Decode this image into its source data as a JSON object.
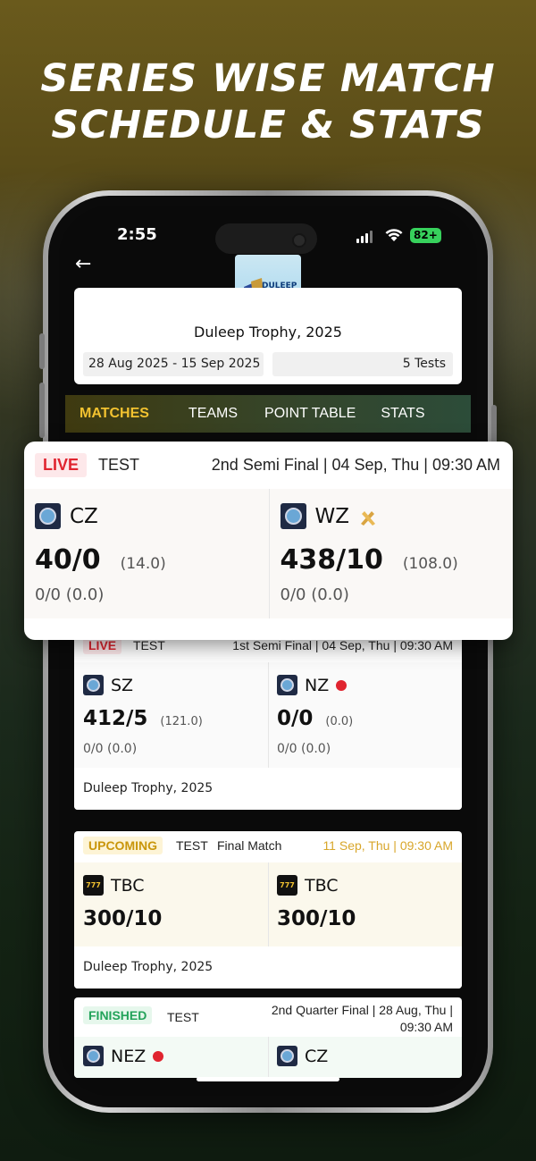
{
  "headline": {
    "line1": "SERIES WISE MATCH",
    "line2": "SCHEDULE & STATS"
  },
  "status": {
    "time": "2:55",
    "battery": "82+"
  },
  "series": {
    "logo_text": "DULEEP",
    "name": "Duleep Trophy, 2025",
    "dates": "28 Aug 2025 - 15 Sep 2025",
    "tests": "5 Tests"
  },
  "tabs": [
    {
      "label": "MATCHES",
      "active": true
    },
    {
      "label": "TEAMS",
      "active": false
    },
    {
      "label": "POINT TABLE",
      "active": false
    },
    {
      "label": "STATS",
      "active": false
    }
  ],
  "popup": {
    "badge": "LIVE",
    "format": "TEST",
    "info": "2nd Semi Final  |  04 Sep, Thu  |  09:30 AM",
    "team1": {
      "name": "CZ",
      "score": "40/0",
      "overs": "(14.0)",
      "sub": "0/0 (0.0)"
    },
    "team2": {
      "name": "WZ",
      "score": "438/10",
      "overs": "(108.0)",
      "sub": "0/0 (0.0)"
    }
  },
  "matches": [
    {
      "badge": "LIVE",
      "format": "TEST",
      "info": "1st Semi Final  |  04 Sep, Thu  |  09:30 AM",
      "team1": {
        "name": "SZ",
        "score": "412/5",
        "overs": "(121.0)",
        "sub": "0/0 (0.0)"
      },
      "team2": {
        "name": "NZ",
        "score": "0/0",
        "overs": "(0.0)",
        "sub": "0/0 (0.0)"
      },
      "footer": "Duleep Trophy, 2025"
    },
    {
      "badge": "UPCOMING",
      "format": "TEST",
      "title": "Final Match",
      "info": "11 Sep, Thu  |  09:30 AM",
      "team1": {
        "name": "TBC",
        "score": "300/10"
      },
      "team2": {
        "name": "TBC",
        "score": "300/10"
      },
      "footer": "Duleep Trophy, 2025"
    },
    {
      "badge": "FINISHED",
      "format": "TEST",
      "info_line1": "2nd Quarter Final  |  28 Aug, Thu  |",
      "info_line2": "09:30 AM",
      "team1": {
        "name": "NEZ"
      },
      "team2": {
        "name": "CZ"
      }
    }
  ],
  "colors": {
    "accent": "#f2c230",
    "live": "#e0242f",
    "upcoming": "#c9960b",
    "finished": "#23a35a"
  }
}
